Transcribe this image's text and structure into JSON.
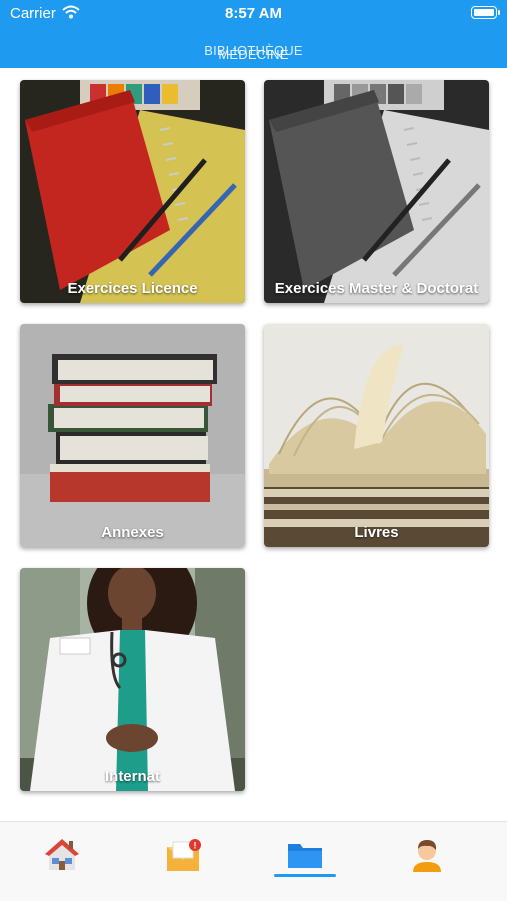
{
  "status_bar": {
    "carrier": "Carrier",
    "time": "8:57 AM"
  },
  "header": {
    "title_line1": "BIBLIOTHÈQUE",
    "title_line2": "MÉDECINE"
  },
  "cards": [
    {
      "label": "Exercices Licence"
    },
    {
      "label": "Exercices Master & Doctorat"
    },
    {
      "label": "Annexes"
    },
    {
      "label": "Livres"
    },
    {
      "label": "Internat"
    }
  ],
  "tabbar": {
    "items": [
      {
        "icon": "home-icon"
      },
      {
        "icon": "mail-icon",
        "badge": "!"
      },
      {
        "icon": "folder-icon",
        "selected": true
      },
      {
        "icon": "profile-icon"
      }
    ],
    "accent": "#1e9bf0"
  }
}
